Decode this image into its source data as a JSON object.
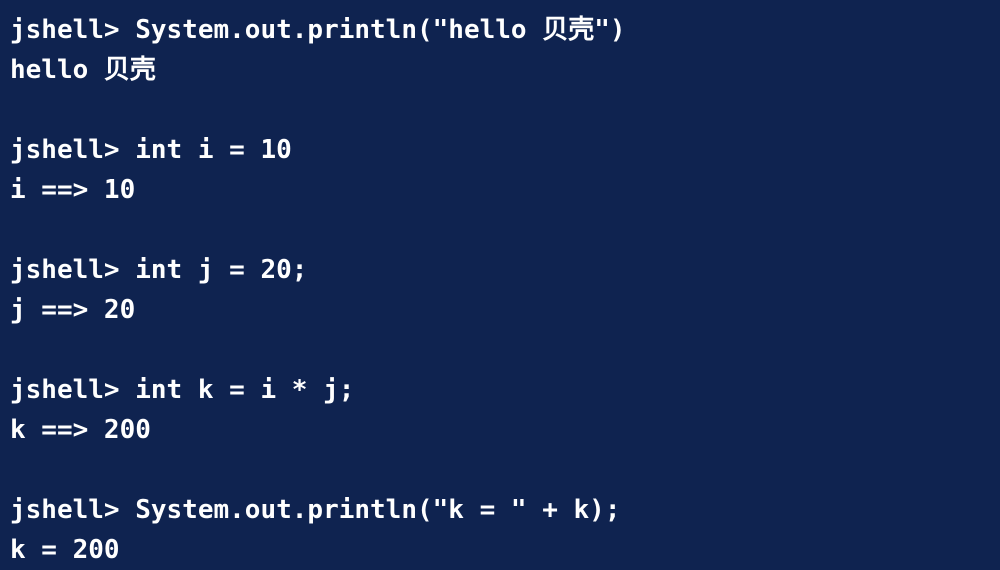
{
  "terminal": {
    "lines": [
      "jshell> System.out.println(\"hello 贝壳\")",
      "hello 贝壳",
      "",
      "jshell> int i = 10",
      "i ==> 10",
      "",
      "jshell> int j = 20;",
      "j ==> 20",
      "",
      "jshell> int k = i * j;",
      "k ==> 200",
      "",
      "jshell> System.out.println(\"k = \" + k);",
      "k = 200"
    ]
  },
  "colors": {
    "background": "#0f2350",
    "text": "#ffffff"
  }
}
